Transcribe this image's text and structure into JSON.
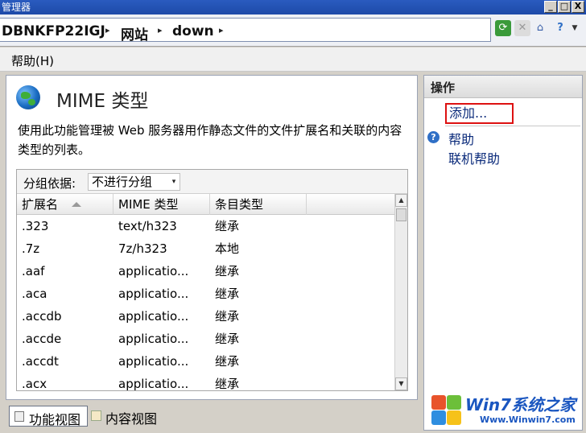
{
  "window": {
    "title": "管理器",
    "controls": {
      "minimize": "_",
      "maximize": "□",
      "close": "X"
    }
  },
  "address": {
    "crumbs": [
      "DBNKFP22IGJ",
      "网站",
      "down"
    ],
    "separator": "▸"
  },
  "menu": {
    "help": "帮助(H)"
  },
  "feature": {
    "title": "MIME 类型",
    "description": "使用此功能管理被 Web 服务器用作静态文件的文件扩展名和关联的内容类型的列表。"
  },
  "grid": {
    "group_label": "分组依据:",
    "group_value": "不进行分组",
    "columns": [
      "扩展名",
      "MIME 类型",
      "条目类型"
    ],
    "rows": [
      [
        ".323",
        "text/h323",
        "继承"
      ],
      [
        ".7z",
        "7z/h323",
        "本地"
      ],
      [
        ".aaf",
        "applicatio...",
        "继承"
      ],
      [
        ".aca",
        "applicatio...",
        "继承"
      ],
      [
        ".accdb",
        "applicatio...",
        "继承"
      ],
      [
        ".accde",
        "applicatio...",
        "继承"
      ],
      [
        ".accdt",
        "applicatio...",
        "继承"
      ],
      [
        ".acx",
        "applicatio...",
        "继承"
      ]
    ]
  },
  "actions": {
    "title": "操作",
    "add": "添加...",
    "help": "帮助",
    "online_help": "联机帮助"
  },
  "views": {
    "features": "功能视图",
    "content": "内容视图"
  },
  "watermark": {
    "brand": "Win7系统之家",
    "url": "Www.Winwin7.com"
  },
  "colors": {
    "highlight_box": "#dd1111",
    "link": "#0a2a7a",
    "titlebar": "#1d4aa8"
  }
}
